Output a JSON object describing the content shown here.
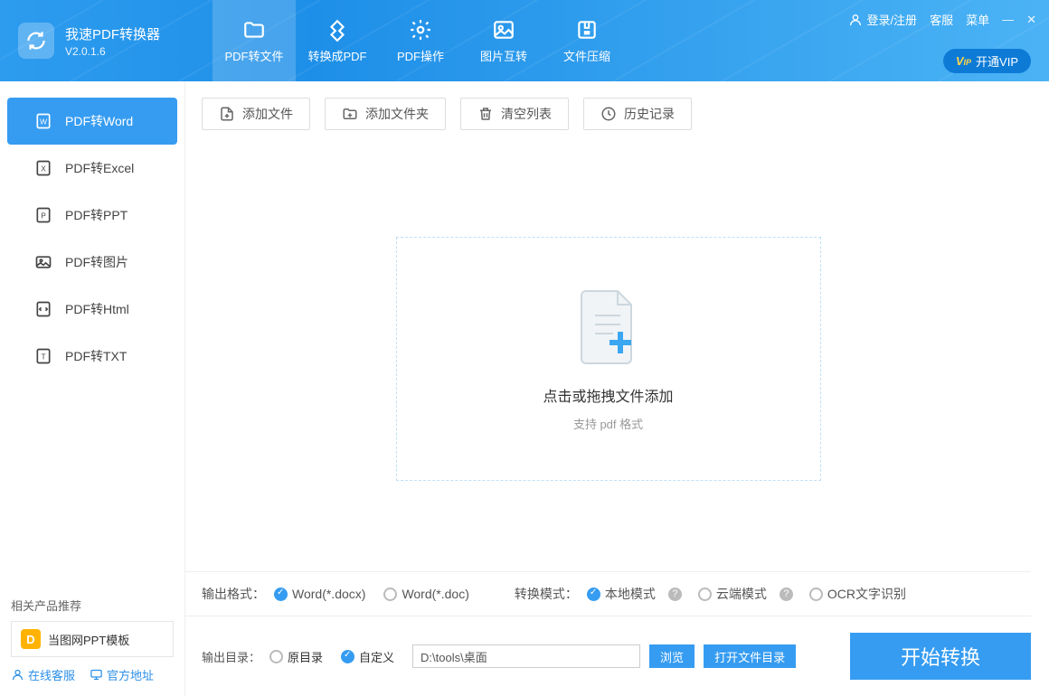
{
  "app": {
    "name": "我速PDF转换器",
    "version": "V2.0.1.6"
  },
  "header": {
    "nav": [
      {
        "label": "PDF转文件",
        "icon": "folder"
      },
      {
        "label": "转换成PDF",
        "icon": "pdf"
      },
      {
        "label": "PDF操作",
        "icon": "gear"
      },
      {
        "label": "图片互转",
        "icon": "image"
      },
      {
        "label": "文件压缩",
        "icon": "zip"
      }
    ],
    "login": "登录/注册",
    "support": "客服",
    "menu": "菜单",
    "vip": "开通VIP"
  },
  "sidebar": {
    "items": [
      {
        "label": "PDF转Word",
        "icon": "W"
      },
      {
        "label": "PDF转Excel",
        "icon": "X"
      },
      {
        "label": "PDF转PPT",
        "icon": "P"
      },
      {
        "label": "PDF转图片",
        "icon": "img"
      },
      {
        "label": "PDF转Html",
        "icon": "</>"
      },
      {
        "label": "PDF转TXT",
        "icon": "T"
      }
    ],
    "related_title": "相关产品推荐",
    "related_item": "当图网PPT模板",
    "online_support": "在线客服",
    "official_site": "官方地址"
  },
  "toolbar": {
    "add_file": "添加文件",
    "add_folder": "添加文件夹",
    "clear_list": "清空列表",
    "history": "历史记录"
  },
  "dropzone": {
    "title": "点击或拖拽文件添加",
    "sub": "支持 pdf 格式"
  },
  "output_format": {
    "label": "输出格式：",
    "options": [
      {
        "label": "Word(*.docx)",
        "checked": true
      },
      {
        "label": "Word(*.doc)",
        "checked": false
      }
    ]
  },
  "convert_mode": {
    "label": "转换模式：",
    "options": [
      {
        "label": "本地模式",
        "checked": true,
        "help": true
      },
      {
        "label": "云端模式",
        "checked": false,
        "help": true
      },
      {
        "label": "OCR文字识别",
        "checked": false,
        "help": false
      }
    ]
  },
  "output_dir": {
    "label": "输出目录：",
    "options": [
      {
        "label": "原目录",
        "checked": false
      },
      {
        "label": "自定义",
        "checked": true
      }
    ],
    "path": "D:\\tools\\桌面",
    "browse": "浏览",
    "open_folder": "打开文件目录"
  },
  "convert_button": "开始转换"
}
